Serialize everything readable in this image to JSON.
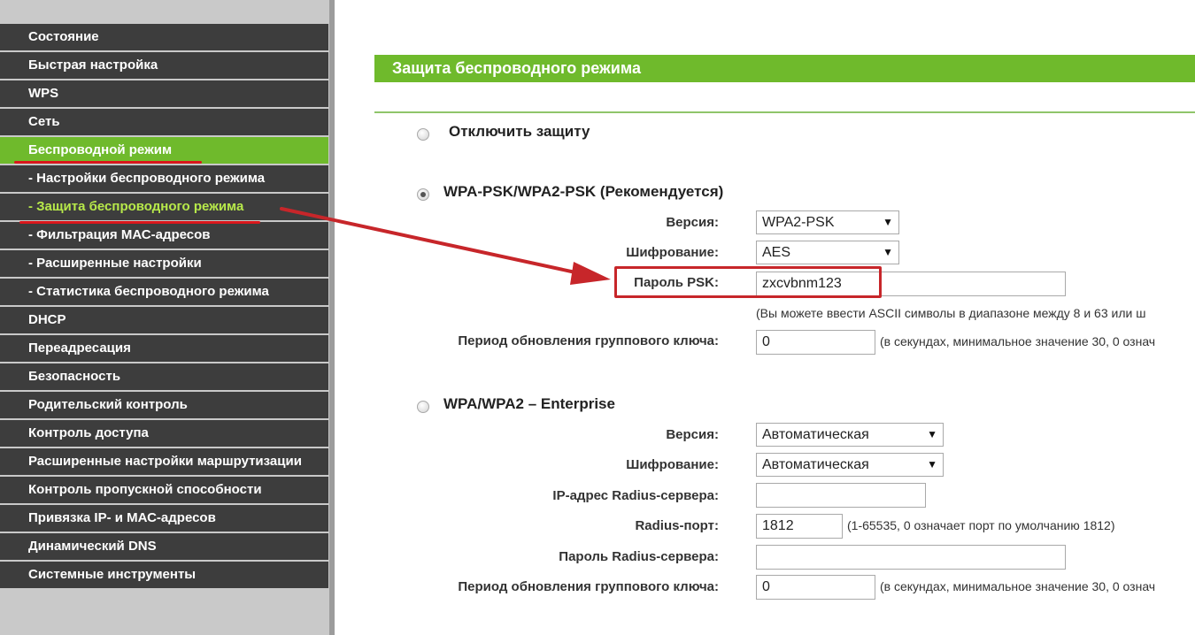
{
  "sidebar": {
    "items": [
      {
        "label": "Состояние"
      },
      {
        "label": "Быстрая настройка"
      },
      {
        "label": "WPS"
      },
      {
        "label": "Сеть"
      },
      {
        "label": "Беспроводной режим"
      },
      {
        "label": "- Настройки беспроводного режима"
      },
      {
        "label": "- Защита беспроводного режима"
      },
      {
        "label": "- Фильтрация МАС-адресов"
      },
      {
        "label": "- Расширенные настройки"
      },
      {
        "label": "- Статистика беспроводного режима"
      },
      {
        "label": "DHCP"
      },
      {
        "label": "Переадресация"
      },
      {
        "label": "Безопасность"
      },
      {
        "label": "Родительский контроль"
      },
      {
        "label": "Контроль доступа"
      },
      {
        "label": "Расширенные настройки маршрутизации"
      },
      {
        "label": "Контроль пропускной способности"
      },
      {
        "label": "Привязка IP- и МАС-адресов"
      },
      {
        "label": "Динамический DNS"
      },
      {
        "label": "Системные инструменты"
      }
    ]
  },
  "main": {
    "title": "Защита беспроводного режима",
    "disable": {
      "label": "Отключить защиту",
      "selected": false
    },
    "wpa_psk": {
      "label": "WPA-PSK/WPA2-PSK (Рекомендуется)",
      "selected": true,
      "version_label": "Версия:",
      "version_value": "WPA2-PSK",
      "encryption_label": "Шифрование:",
      "encryption_value": "AES",
      "psk_label": "Пароль PSK:",
      "psk_value": "zxcvbnm123",
      "psk_hint": "(Вы можете ввести ASCII символы в диапазоне между 8 и 63 или ш",
      "group_key_label": "Период обновления группового ключа:",
      "group_key_value": "0",
      "group_key_hint": "(в секундах, минимальное значение 30, 0 означ"
    },
    "enterprise": {
      "label": "WPA/WPA2 – Enterprise",
      "selected": false,
      "version_label": "Версия:",
      "version_value": "Автоматическая",
      "encryption_label": "Шифрование:",
      "encryption_value": "Автоматическая",
      "radius_ip_label": "IP-адрес Radius-сервера:",
      "radius_ip_value": "",
      "radius_port_label": "Radius-порт:",
      "radius_port_value": "1812",
      "radius_port_hint": "(1-65535, 0 означает порт по умолчанию 1812)",
      "radius_password_label": "Пароль Radius-сервера:",
      "radius_password_value": "",
      "group_key_label": "Период обновления группового ключа:",
      "group_key_value": "0",
      "group_key_hint": "(в секундах, минимальное значение 30, 0 означ"
    }
  },
  "icons": {
    "dropdown": "dropdown-arrow-icon",
    "radio": "radio-icon"
  },
  "colors": {
    "accent_green": "#6fba2c",
    "menu_bg": "#3d3d3d",
    "current_submenu_text": "#b7e94a",
    "annotation_red": "#c7262a"
  }
}
